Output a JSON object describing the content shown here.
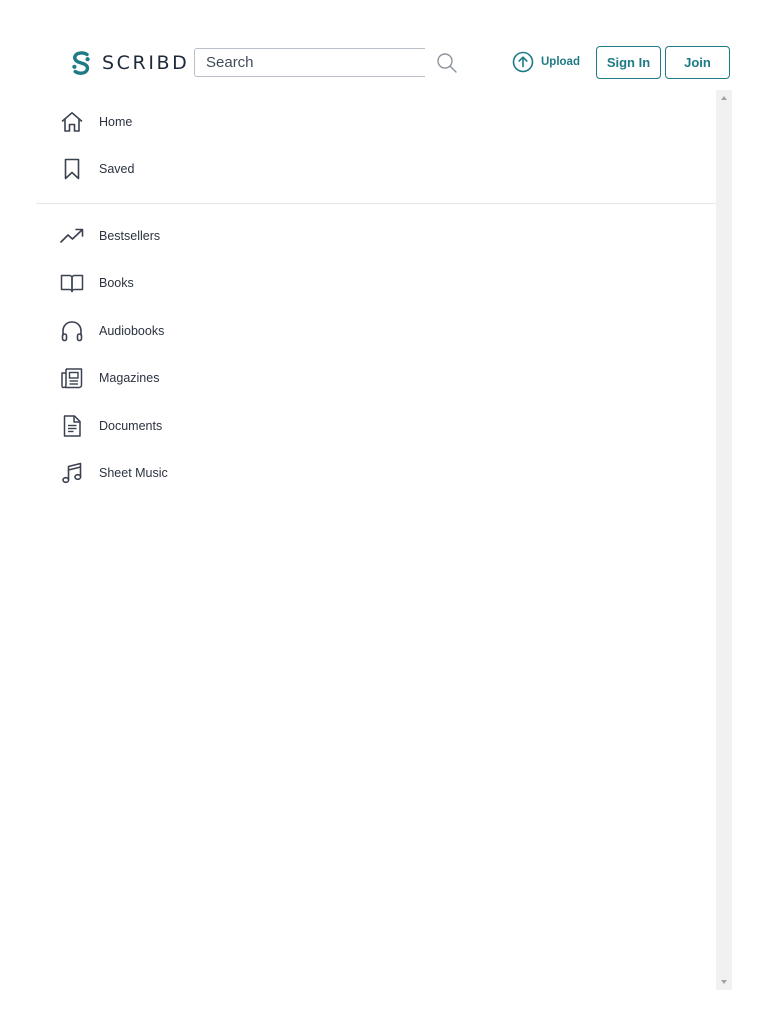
{
  "header": {
    "brand": "SCRIBD",
    "search": {
      "placeholder": "Search",
      "value": ""
    },
    "upload_label": "Upload",
    "signin_label": "Sign In",
    "join_label": "Join"
  },
  "nav_primary": [
    {
      "label": "Home",
      "icon": "home-icon"
    },
    {
      "label": "Saved",
      "icon": "bookmark-icon"
    }
  ],
  "nav_browse": [
    {
      "label": "Bestsellers",
      "icon": "trending-icon"
    },
    {
      "label": "Books",
      "icon": "book-icon"
    },
    {
      "label": "Audiobooks",
      "icon": "headphones-icon"
    },
    {
      "label": "Magazines",
      "icon": "magazine-icon"
    },
    {
      "label": "Documents",
      "icon": "document-icon"
    },
    {
      "label": "Sheet Music",
      "icon": "music-icon"
    }
  ],
  "colors": {
    "accent": "#1e7b85",
    "text": "#1e2a3a",
    "icon": "#3a4250",
    "divider": "#e3e6ea",
    "scrollbar": "#f1f1f1"
  }
}
